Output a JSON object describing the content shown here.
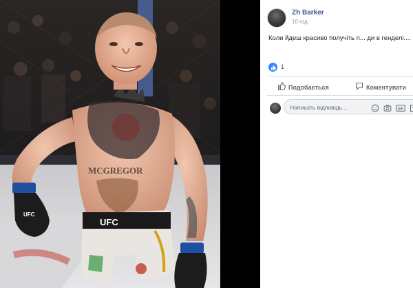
{
  "post": {
    "author": "Zh Barker",
    "timestamp": "10 год",
    "text": "Коли йдеш красиво получіть п... ди в генделі....",
    "like_count": "1"
  },
  "actions": {
    "like_label": "Подобається",
    "comment_label": "Коментувати"
  },
  "comment_box": {
    "placeholder": "Напишіть відповідь..."
  },
  "icons": {
    "like": "thumbs-up-icon",
    "comment": "speech-bubble-icon",
    "emoji": "smiley-icon",
    "camera": "camera-icon",
    "gif": "gif-icon",
    "sticker": "sticker-icon"
  },
  "colors": {
    "author_link": "#385898",
    "like_blue": "#2d88ff",
    "muted_text": "#606770"
  },
  "photo": {
    "shorts_text": "UFC",
    "tattoo_text": "MCGREGOR",
    "glove_text": "UFC"
  }
}
